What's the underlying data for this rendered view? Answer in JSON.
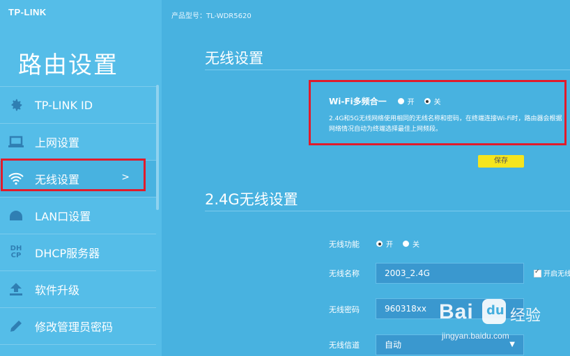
{
  "brand": "TP-LINK",
  "model_text": "产品型号：TL-WDR5620",
  "sidebar": {
    "title": "路由设置",
    "items": [
      {
        "label": "TP-LINK ID",
        "icon": "gear-icon"
      },
      {
        "label": "上网设置",
        "icon": "laptop-icon"
      },
      {
        "label": "无线设置",
        "icon": "wifi-icon",
        "arrow": ">"
      },
      {
        "label": "LAN口设置",
        "icon": "network-icon"
      },
      {
        "label": "DHCP服务器",
        "icon": "dhcp-icon",
        "icon_text": "DH CP"
      },
      {
        "label": "软件升级",
        "icon": "upload-icon"
      },
      {
        "label": "修改管理员密码",
        "icon": "pencil-icon"
      }
    ]
  },
  "wireless": {
    "title": "无线设置",
    "wifi_merge_label": "Wi-Fi多频合一",
    "on_label": "开",
    "off_label": "关",
    "wifi_merge_value": "关",
    "description": "2.4G和5G无线网络使用相同的无线名称和密码，在终端连接Wi-Fi时，路由器会根据网络情况自动为终端选择最佳上网频段。",
    "save_label": "保存"
  },
  "band24": {
    "title": "2.4G无线设置",
    "enable_label": "无线功能",
    "enable_on": "开",
    "enable_off": "关",
    "enable_value": "开",
    "ssid_label": "无线名称",
    "ssid_value": "2003_2.4G",
    "broadcast_label": "开启无线",
    "password_label": "无线密码",
    "password_value": "960318xx",
    "channel_label": "无线信道",
    "channel_value": "自动"
  },
  "watermark": {
    "text": "Bai",
    "paw_text": "du",
    "cn": "经验",
    "url": "jingyan.baidu.com"
  },
  "colors": {
    "background": "#48b2e0",
    "sidebar": "#55bde8",
    "highlight": "#e11b2b",
    "save_button": "#f5e51d"
  }
}
